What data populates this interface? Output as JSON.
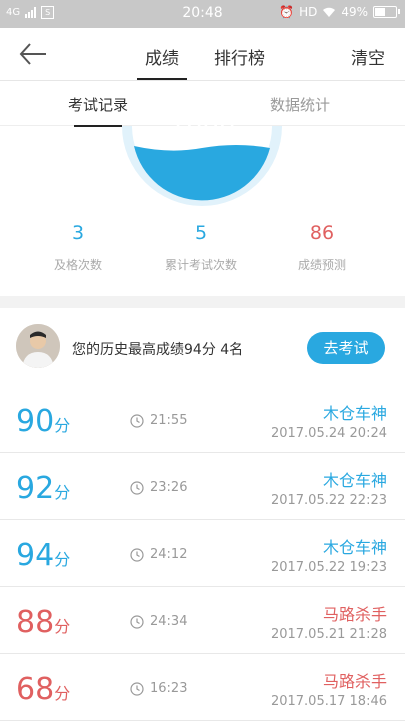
{
  "status_bar": {
    "network": "4G",
    "time": "20:48",
    "hd": "HD",
    "battery": "49%",
    "sim_icon": "S"
  },
  "nav": {
    "back_icon": "arrow-left",
    "tab_score": "成绩",
    "tab_rank": "排行榜",
    "clear": "清空"
  },
  "subtabs": {
    "records": "考试记录",
    "stats": "数据统计"
  },
  "gauge": {
    "value": "1000"
  },
  "stats": [
    {
      "value": "3",
      "label": "及格次数",
      "color": "#29a8e0"
    },
    {
      "value": "5",
      "label": "累计考试次数",
      "color": "#29a8e0"
    },
    {
      "value": "86",
      "label": "成绩预测",
      "color": "#e06060"
    }
  ],
  "best": {
    "text": "您的历史最高成绩94分  4名",
    "button": "去考试"
  },
  "records": [
    {
      "score": "90",
      "unit": "分",
      "duration": "21:55",
      "title": "木仓车神",
      "date": "2017.05.24  20:24",
      "color": "blue"
    },
    {
      "score": "92",
      "unit": "分",
      "duration": "23:26",
      "title": "木仓车神",
      "date": "2017.05.22  22:23",
      "color": "blue"
    },
    {
      "score": "94",
      "unit": "分",
      "duration": "24:12",
      "title": "木仓车神",
      "date": "2017.05.22  19:23",
      "color": "blue"
    },
    {
      "score": "88",
      "unit": "分",
      "duration": "24:34",
      "title": "马路杀手",
      "date": "2017.05.21  21:28",
      "color": "red"
    },
    {
      "score": "68",
      "unit": "分",
      "duration": "16:23",
      "title": "马路杀手",
      "date": "2017.05.17  18:46",
      "color": "red"
    }
  ],
  "colors": {
    "accent": "#29a8e0",
    "warn": "#e06060"
  }
}
